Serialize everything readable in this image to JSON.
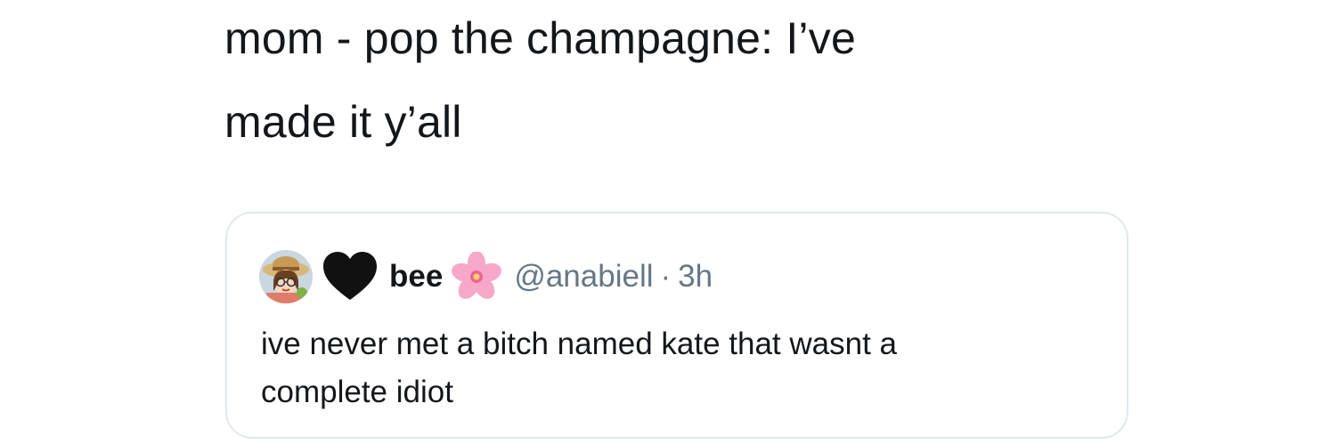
{
  "tweet": {
    "text_lines": [
      "mom - pop the champagne: I’ve",
      "made it y’all"
    ]
  },
  "quoted_tweet": {
    "display_name": "bee",
    "handle": "@anabiell",
    "separator": "·",
    "time": "3h",
    "text_lines": [
      "ive never met a bitch named kate that wasnt a",
      "complete idiot"
    ],
    "icons": {
      "avatar": "avatar-image",
      "heart": "black-heart-icon",
      "flower": "cherry-blossom-icon"
    }
  },
  "colors": {
    "text": "#14171a",
    "secondary_text": "#657786",
    "card_border": "#e1e8ed"
  }
}
